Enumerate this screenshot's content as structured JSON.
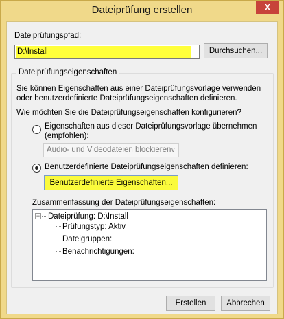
{
  "window": {
    "title": "Dateiprüfung erstellen",
    "close_label": "X"
  },
  "path": {
    "label": "Dateiprüfungspfad:",
    "value": "D:\\Install",
    "browse_label": "Durchsuchen..."
  },
  "properties_group": {
    "legend": "Dateiprüfungseigenschaften",
    "description": "Sie können Eigenschaften aus einer Dateiprüfungsvorlage verwenden oder benutzerdefinierte Dateiprüfungseigenschaften definieren.",
    "question": "Wie möchten Sie die Dateiprüfungseigenschaften konfigurieren?",
    "option_template": {
      "label_line1": "Eigenschaften aus dieser Dateiprüfungsvorlage übernehmen",
      "label_line2": "(empfohlen):",
      "selected": false
    },
    "template_select": {
      "value": "Audio- und Videodateien blockieren",
      "arrow": "∨"
    },
    "option_custom": {
      "label": "Benutzerdefinierte Dateiprüfungseigenschaften definieren:",
      "selected": true
    },
    "custom_button_label": "Benutzerdefinierte Eigenschaften...",
    "summary_label": "Zusammenfassung der Dateiprüfungseigenschaften:",
    "summary_tree": {
      "expander": "−",
      "root": "Dateiprüfung: D:\\Install",
      "children": [
        "Prüfungstyp: Aktiv",
        "Dateigruppen:",
        "Benachrichtigungen:"
      ]
    }
  },
  "footer": {
    "create_label": "Erstellen",
    "cancel_label": "Abbrechen"
  }
}
